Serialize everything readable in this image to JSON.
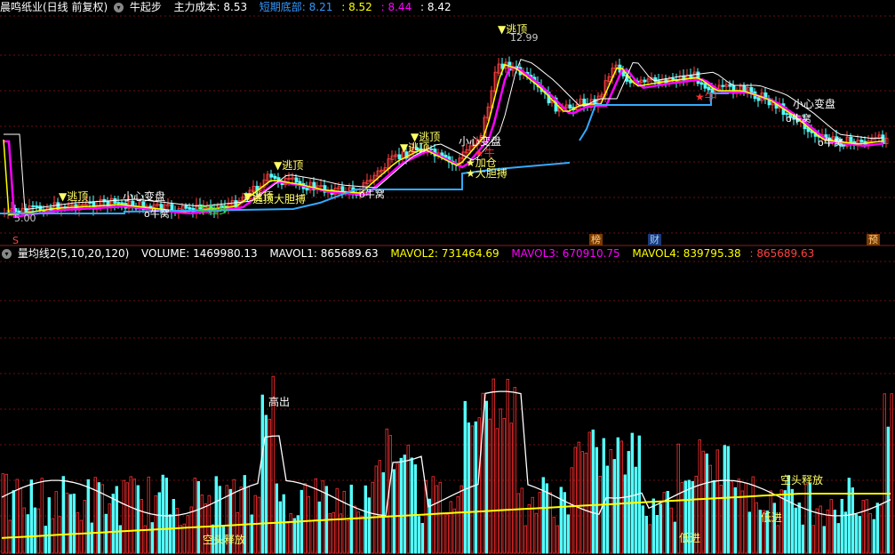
{
  "colors": {
    "bg": "#000000",
    "up": "#ff4040",
    "down": "#54ffff",
    "white": "#ffffff",
    "yellow": "#ffff00",
    "magenta": "#ff00ff",
    "blue": "#3399ff",
    "grid": "#6a1010",
    "gold": "#ffcc00",
    "green": "#33dd33"
  },
  "main_panel": {
    "title": "晨鸣纸业(日线 前复权)",
    "indicator": "牛起步",
    "cost_label": "主力成本:",
    "cost_value": "8.53",
    "bottom_label": "短期底部:",
    "bottom_value": "8.21",
    "v3": "8.52",
    "v4": "8.44",
    "v5": "8.42",
    "high_price": "12.99",
    "low_price": "5.00",
    "annotations": {
      "escape_top": "▼逃顶",
      "careful": "小心变盘",
      "bull_nest": "o牛窝",
      "add_pos": "★加仓",
      "bold": "★大胆搏",
      "bull_red": "★牛",
      "bull_start": "牛起步",
      "top_bottom": "逃顶大胆搏"
    },
    "markers": {
      "s": "S",
      "bang": "榜",
      "cai": "财",
      "yu": "预"
    }
  },
  "volume_panel": {
    "title": "量均线2(5,10,20,120)",
    "volume_label": "VOLUME:",
    "volume_value": "1469980.13",
    "mavol1_label": "MAVOL1:",
    "mavol1_value": "865689.63",
    "mavol2_label": "MAVOL2:",
    "mavol2_value": "731464.69",
    "mavol3_label": "MAVOL3:",
    "mavol3_value": "670910.75",
    "mavol4_label": "MAVOL4:",
    "mavol4_value": "839795.38",
    "extra_value": "865689.63",
    "annotations": {
      "high_out": "高出",
      "bear_release": "空头释放",
      "low_in": "低进"
    }
  }
}
